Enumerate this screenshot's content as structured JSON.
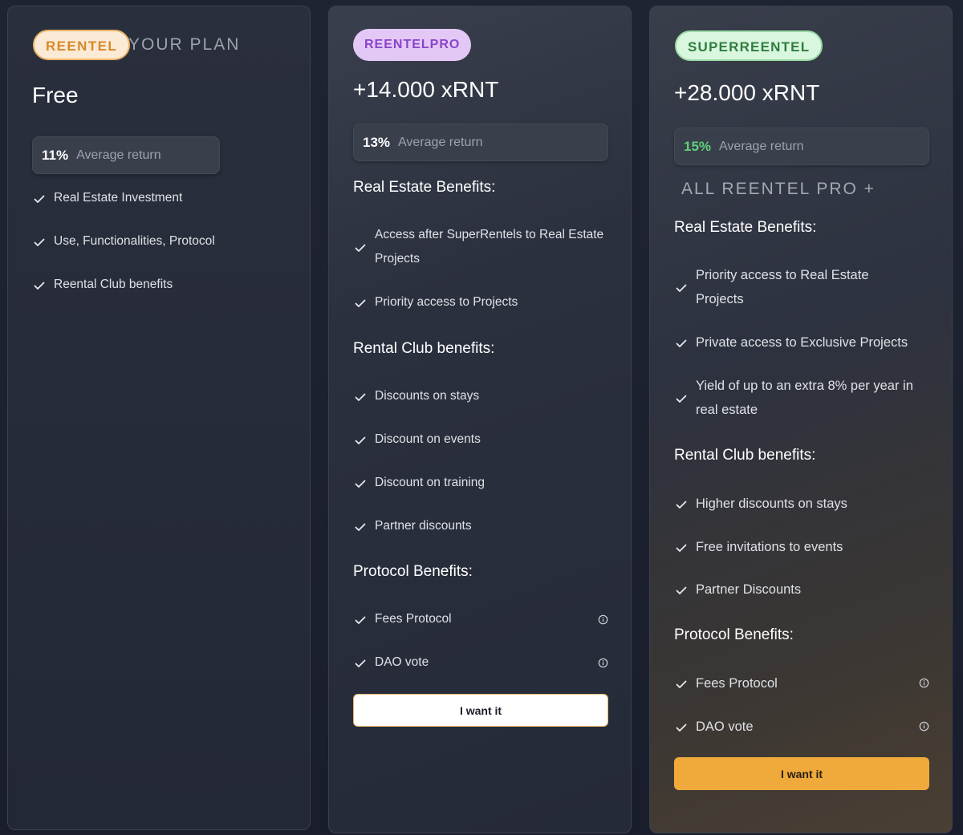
{
  "plans": [
    {
      "badge": "REENTEL",
      "tag": "YOUR PLAN",
      "price": "Free",
      "return_pct": "11%",
      "return_label": "Average return",
      "items": [
        "Real Estate Investment",
        "Use, Functionalities, Protocol",
        "Reental Club benefits"
      ]
    },
    {
      "badge": "REENTELPRO",
      "price": "+14.000 xRNT",
      "return_pct": "13%",
      "return_label": "Average return",
      "real_estate_title": "Real Estate Benefits:",
      "real_estate_items": [
        [
          "Access after SuperRentels to Real Estate",
          "Projects"
        ],
        [
          "Priority access to Projects"
        ]
      ],
      "rental_title": "Rental Club benefits:",
      "rental_items": [
        "Discounts on stays",
        "Discount on events",
        "Discount on training",
        "Partner discounts"
      ],
      "protocol_title": "Protocol Benefits:",
      "protocol_items": [
        "Fees Protocol",
        "DAO vote"
      ],
      "button": "I want it"
    },
    {
      "badge": "SUPERREENTEL",
      "price": "+28.000 xRNT",
      "return_pct": "15%",
      "return_label": "Average return",
      "all_pro": "ALL REENTEL PRO +",
      "real_estate_title": "Real Estate Benefits:",
      "real_estate_items": [
        [
          "Priority access to Real Estate",
          "Projects"
        ],
        [
          "Private access to Exclusive Projects"
        ],
        [
          "Yield of up to an extra 8% per year in",
          "real estate"
        ]
      ],
      "rental_title": "Rental Club benefits:",
      "rental_items": [
        "Higher discounts on stays",
        "Free invitations to events",
        "Partner Discounts"
      ],
      "protocol_title": "Protocol Benefits:",
      "protocol_items": [
        "Fees Protocol",
        "DAO vote"
      ],
      "button": "I want it"
    }
  ],
  "colors": {
    "badge_reentel": "#d7892a",
    "badge_pro": "#8a44c9",
    "badge_super": "#2f7d3f",
    "return_green": "#5fd07a",
    "button_orange": "#f0a93b"
  },
  "icons": {
    "check": "check-icon",
    "info": "info-icon"
  }
}
